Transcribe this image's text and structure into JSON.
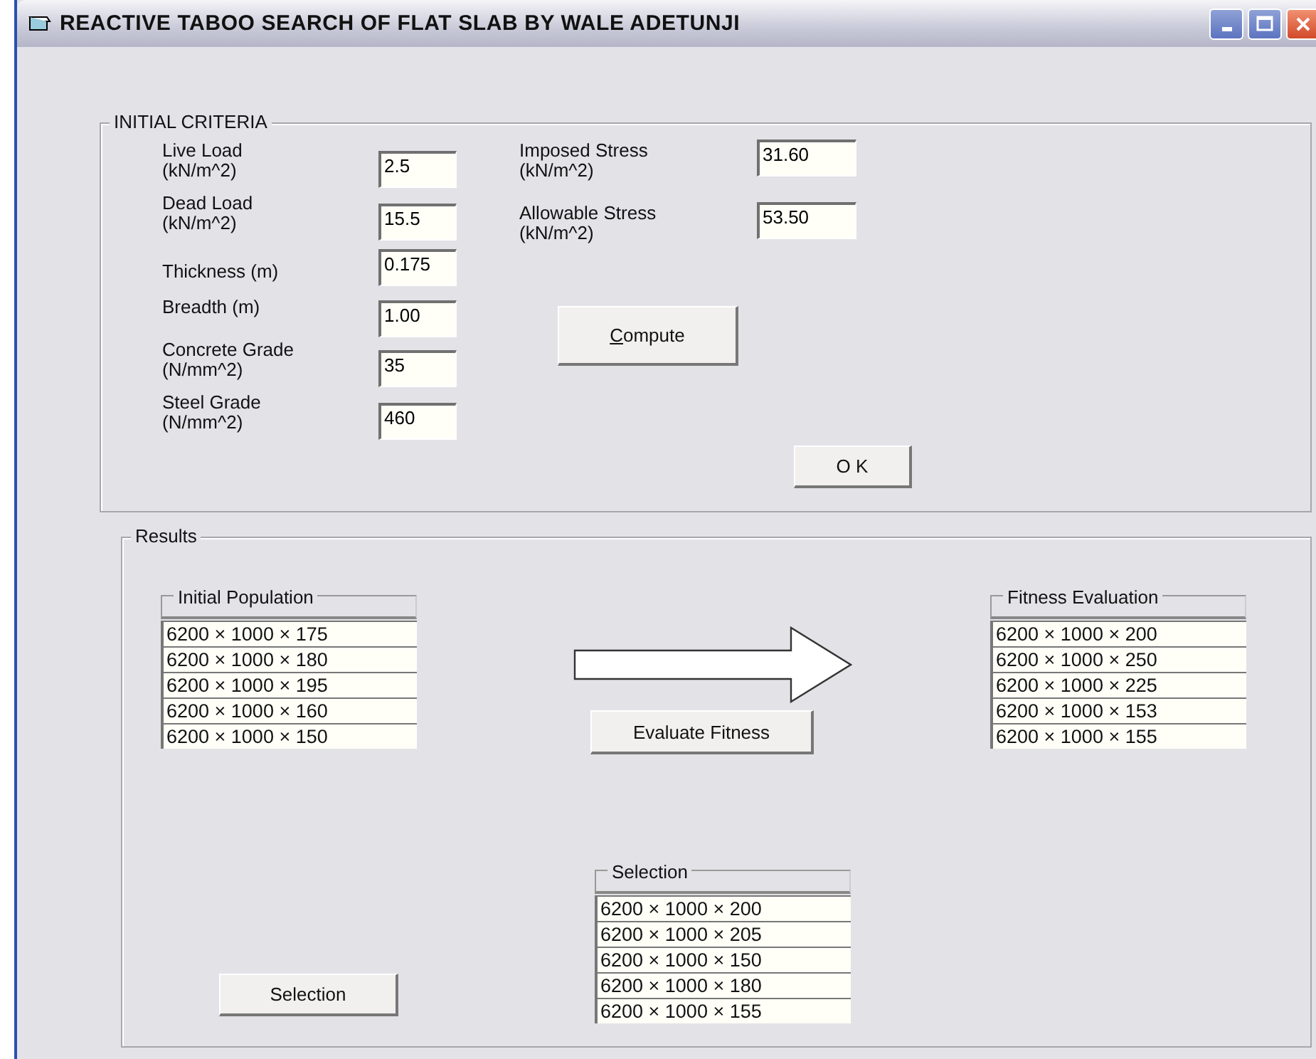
{
  "window": {
    "title": "REACTIVE TABOO SEARCH OF FLAT SLAB BY WALE ADETUNJI"
  },
  "initial_criteria": {
    "title": "INITIAL CRITERIA",
    "inputs": [
      {
        "label_lines": [
          "Live Load",
          "(kN/m^2)"
        ],
        "value": "2.5"
      },
      {
        "label_lines": [
          "Dead Load",
          "(kN/m^2)"
        ],
        "value": "15.5"
      },
      {
        "label_lines": [
          "Thickness (m)"
        ],
        "value": "0.175"
      },
      {
        "label_lines": [
          "Breadth (m)"
        ],
        "value": "1.00"
      },
      {
        "label_lines": [
          "Concrete Grade",
          "(N/mm^2)"
        ],
        "value": "35"
      },
      {
        "label_lines": [
          "Steel Grade",
          "(N/mm^2)"
        ],
        "value": "460"
      }
    ],
    "stress_inputs": [
      {
        "label_lines": [
          "Imposed Stress",
          "(kN/m^2)"
        ],
        "value": "31.60"
      },
      {
        "label_lines": [
          "Allowable Stress",
          "(kN/m^2)"
        ],
        "value": "53.50"
      }
    ],
    "compute_button": {
      "accelerator": "C",
      "rest": "ompute"
    },
    "ok_button": {
      "label": "O K"
    }
  },
  "results": {
    "title": "Results",
    "initial_population": {
      "title": "Initial Population",
      "items": [
        "6200 × 1000 × 175",
        "6200 × 1000 × 180",
        "6200 × 1000 × 195",
        "6200 × 1000 × 160",
        "6200 × 1000 × 150"
      ]
    },
    "evaluate_button": {
      "label": "Evaluate Fitness"
    },
    "fitness_evaluation": {
      "title": "Fitness Evaluation",
      "items": [
        "6200 × 1000 × 200",
        "6200 × 1000 × 250",
        "6200 × 1000 × 225",
        "6200 × 1000 × 153",
        "6200 × 1000 × 155"
      ]
    },
    "selection": {
      "title": "Selection",
      "items": [
        "6200 × 1000 × 200",
        "6200 × 1000 × 205",
        "6200 × 1000 × 150",
        "6200 × 1000 × 180",
        "6200 × 1000 × 155"
      ]
    },
    "selection_button": {
      "label": "Selection"
    }
  }
}
